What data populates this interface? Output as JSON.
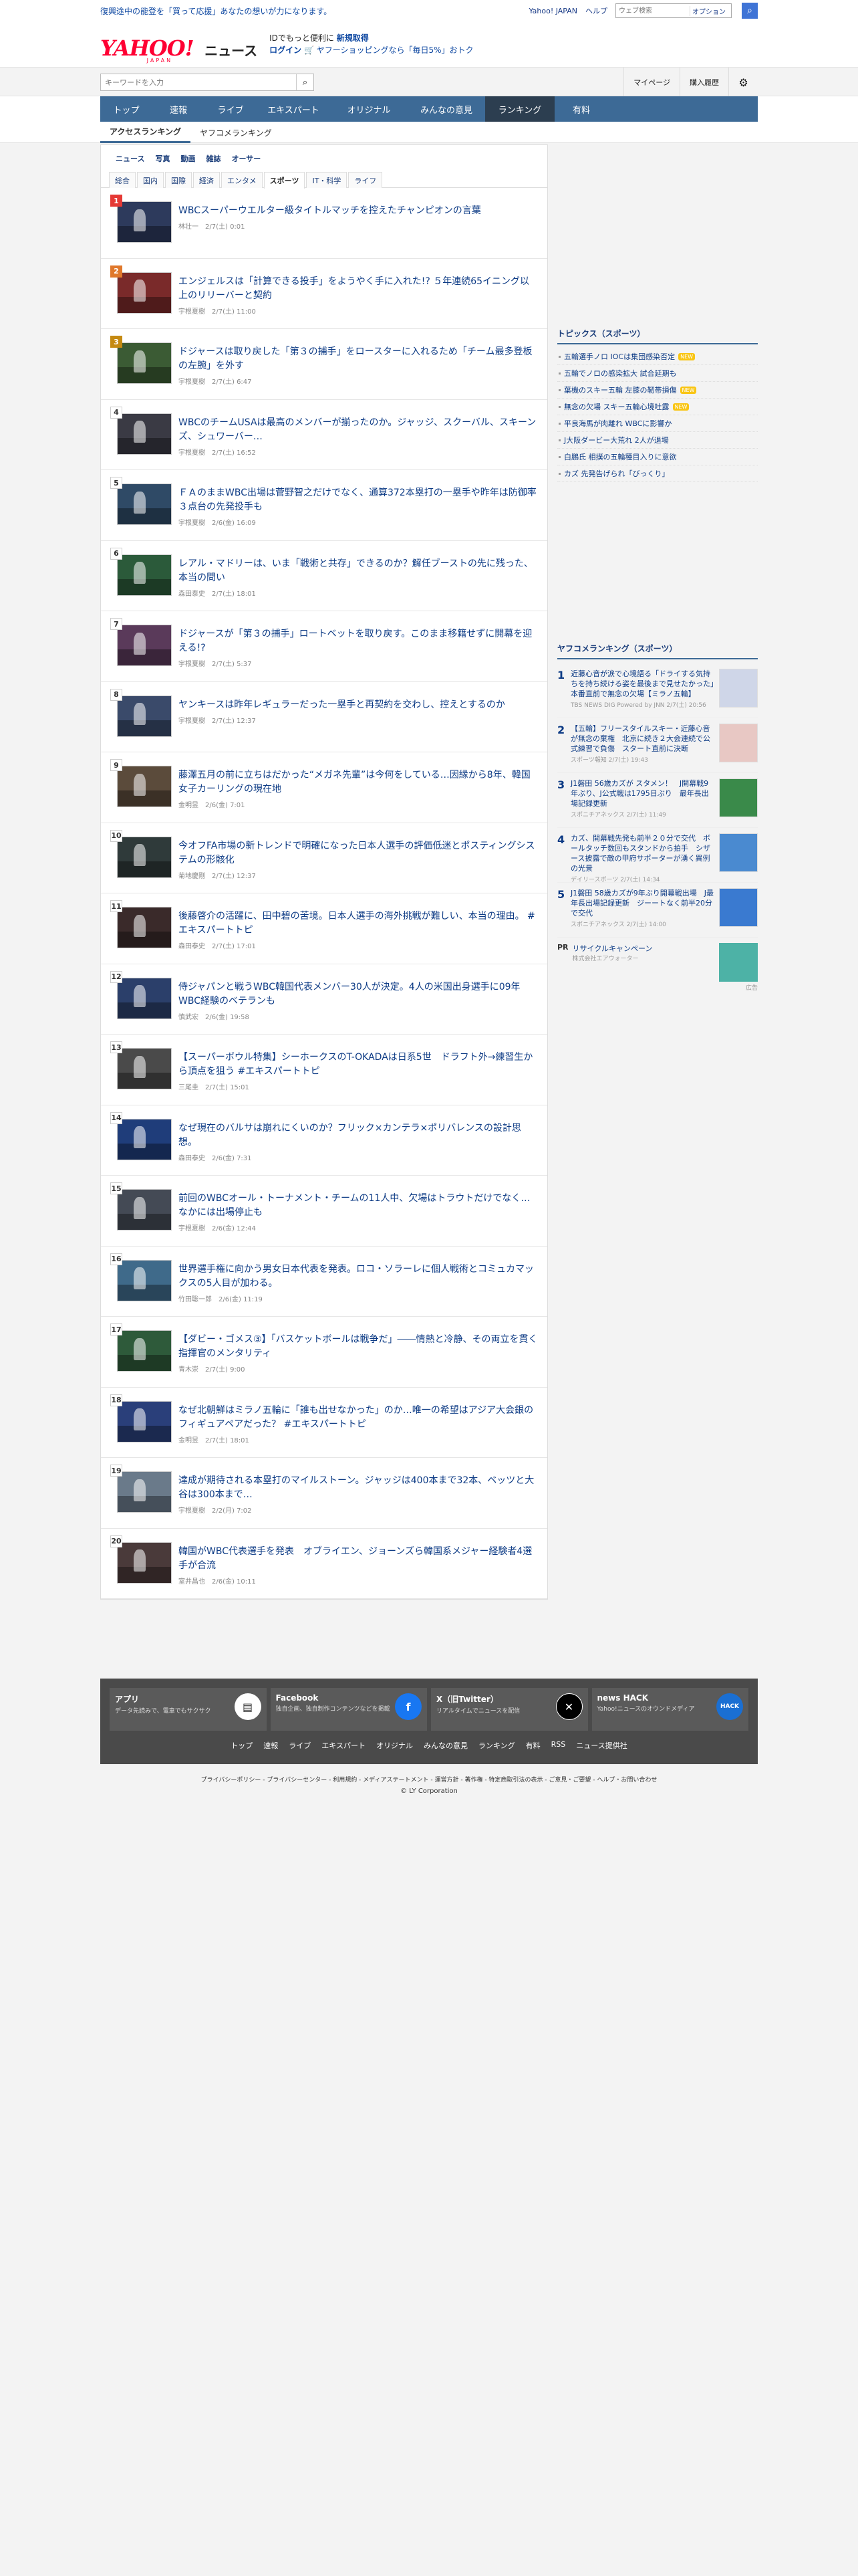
{
  "top_strip": {
    "ad_text": "復興途中の能登を「買って応援」あなたの想いが力になります。",
    "links": [
      "Yahoo! JAPAN",
      "ヘルプ"
    ],
    "search_placeholder": "ウェブ検索",
    "search_scope": "オプション"
  },
  "header": {
    "logo_main": "YAHOO!",
    "logo_sub": "JAPAN",
    "logo_news": "ニュース",
    "promo_line1_prefix": "IDでもっと便利に",
    "promo_line1_link": "新規取得",
    "promo_line2_login": "ログイン",
    "promo_line2_text": "ヤフーショッピングなら「毎日5%」おトク"
  },
  "searchbar": {
    "placeholder": "キーワードを入力",
    "right_items": [
      "マイページ",
      "購入履歴"
    ]
  },
  "nav": {
    "tabs": [
      "トップ",
      "速報",
      "ライブ",
      "エキスパート",
      "オリジナル",
      "みんなの意見",
      "ランキング",
      "有料"
    ],
    "active_index": 6
  },
  "subtabs": {
    "items": [
      "アクセスランキング",
      "ヤフコメランキング"
    ],
    "active_index": 0
  },
  "category_tabs": [
    "ニュース",
    "写真",
    "動画",
    "雑誌",
    "オーサー"
  ],
  "subcategory_tabs": {
    "items": [
      "総合",
      "国内",
      "国際",
      "経済",
      "エンタメ",
      "スポーツ",
      "IT・科学",
      "ライフ"
    ],
    "active_index": 5
  },
  "ranking": [
    {
      "rank": "1",
      "title": "WBCスーパーウエルター級タイトルマッチを控えたチャンピオンの言葉",
      "source": "林壮一",
      "time": "2/7(土) 0:01"
    },
    {
      "rank": "2",
      "title": "エンジェルスは「計算できる投手」をようやく手に入れた!? ５年連続65イニング以上のリリーバーと契約",
      "source": "宇根夏樹",
      "time": "2/7(土) 11:00"
    },
    {
      "rank": "3",
      "title": "ドジャースは取り戻した「第３の捕手」をロースターに入れるため「チーム最多登板の左腕」を外す",
      "source": "宇根夏樹",
      "time": "2/7(土) 6:47"
    },
    {
      "rank": "4",
      "title": "WBCのチームUSAは最高のメンバーが揃ったのか。ジャッジ、スクーバル、スキーンズ、シュワーバー…",
      "source": "宇根夏樹",
      "time": "2/7(土) 16:52"
    },
    {
      "rank": "5",
      "title": "ＦＡのままWBC出場は菅野智之だけでなく、通算372本塁打の一塁手や昨年は防御率３点台の先発投手も",
      "source": "宇根夏樹",
      "time": "2/6(金) 16:09"
    },
    {
      "rank": "6",
      "title": "レアル・マドリーは、いま「戦術と共存」できるのか？解任ブーストの先に残った、本当の問い",
      "source": "森田泰史",
      "time": "2/7(土) 18:01"
    },
    {
      "rank": "7",
      "title": "ドジャースが「第３の捕手」ロートベットを取り戻す。このまま移籍せずに開幕を迎える!?",
      "source": "宇根夏樹",
      "time": "2/7(土) 5:37"
    },
    {
      "rank": "8",
      "title": "ヤンキースは昨年レギュラーだった一塁手と再契約を交わし、控えとするのか",
      "source": "宇根夏樹",
      "time": "2/7(土) 12:37"
    },
    {
      "rank": "9",
      "title": "藤澤五月の前に立ちはだかった“メガネ先輩”は今何をしている…因縁から8年、韓国女子カーリングの現在地",
      "source": "金明昱",
      "time": "2/6(金) 7:01"
    },
    {
      "rank": "10",
      "title": "今オフFA市場の新トレンドで明確になった日本人選手の評価低迷とポスティングシステムの形骸化",
      "source": "菊地慶剛",
      "time": "2/7(土) 12:37"
    },
    {
      "rank": "11",
      "title": "後藤啓介の活躍に、田中碧の苦境。日本人選手の海外挑戦が難しい、本当の理由。 #エキスパートトピ",
      "source": "森田泰史",
      "time": "2/7(土) 17:01"
    },
    {
      "rank": "12",
      "title": "侍ジャパンと戦うWBC韓国代表メンバー30人が決定。4人の米国出身選手に09年WBC経験のベテランも",
      "source": "慎武宏",
      "time": "2/6(金) 19:58"
    },
    {
      "rank": "13",
      "title": "【スーパーボウル特集】シーホークスのT-OKADAは日系5世　ドラフト外→練習生から頂点を狙う #エキスパートトピ",
      "source": "三尾圭",
      "time": "2/7(土) 15:01"
    },
    {
      "rank": "14",
      "title": "なぜ現在のバルサは崩れにくいのか？フリック×カンテラ×ポリバレンスの設計思想。",
      "source": "森田泰史",
      "time": "2/6(金) 7:31"
    },
    {
      "rank": "15",
      "title": "前回のWBCオール・トーナメント・チームの11人中、欠場はトラウトだけでなく…なかには出場停止も",
      "source": "宇根夏樹",
      "time": "2/6(金) 12:44"
    },
    {
      "rank": "16",
      "title": "世界選手権に向かう男女日本代表を発表。ロコ・ソラーレに個人戦術とコミュカマックスの5人目が加わる。",
      "source": "竹田聡一郎",
      "time": "2/6(金) 11:19"
    },
    {
      "rank": "17",
      "title": "【ダビー・ゴメス③】「バスケットボールは戦争だ」――情熱と冷静、その両立を貫く指揮官のメンタリティ",
      "source": "青木崇",
      "time": "2/7(土) 9:00"
    },
    {
      "rank": "18",
      "title": "なぜ北朝鮮はミラノ五輪に「誰も出せなかった」のか…唯一の希望はアジア大会銀のフィギュアペアだった？ #エキスパートトピ",
      "source": "金明昱",
      "time": "2/7(土) 18:01"
    },
    {
      "rank": "19",
      "title": "達成が期待される本塁打のマイルストーン。ジャッジは400本まで32本、ベッツと大谷は300本まで…",
      "source": "宇根夏樹",
      "time": "2/2(月) 7:02"
    },
    {
      "rank": "20",
      "title": "韓国がWBC代表選手を発表　オブライエン、ジョーンズら韓国系メジャー経験者4選手が合流",
      "source": "室井昌也",
      "time": "2/6(金) 10:11"
    }
  ],
  "sidebar": {
    "topics_title": "トピックス（スポーツ）",
    "topics": [
      {
        "text": "五輪選手ノロ IOCは集団感染否定",
        "new": true
      },
      {
        "text": "五輪でノロの感染拡大 試合延期も",
        "new": false
      },
      {
        "text": "葉機のスキー五輪 左膝の靭帯損傷",
        "new": true
      },
      {
        "text": "無念の欠場 スキー五輪心境吐露",
        "new": true
      },
      {
        "text": "平良海馬が肉離れ WBCに影響か",
        "new": false
      },
      {
        "text": "J大阪ダービー大荒れ 2人が退場",
        "new": false
      },
      {
        "text": "白鵬氏 相撲の五輪種目入りに意欲",
        "new": false
      },
      {
        "text": "カズ 先発告げられ「びっくり」",
        "new": false
      }
    ],
    "new_badge": "NEW",
    "yahoo_ranking_title": "ヤフコメランキング（スポーツ）",
    "yahoo_ranking": [
      {
        "rank": "1",
        "title": "近藤心音が涙で心境語る「ドライする気持ちを持ち続ける姿を最後まで見せたかった」本番直前で無念の欠場【ミラノ五輪】",
        "meta": "TBS NEWS DIG Powered by JNN 2/7(土) 20:56"
      },
      {
        "rank": "2",
        "title": "【五輪】フリースタイルスキー・近藤心音が無念の棄権　北京に続き２大会連続で公式練習で負傷　スタート直前に決断",
        "meta": "スポーツ報知 2/7(土) 19:43"
      },
      {
        "rank": "3",
        "title": "J1磐田 56歳カズが スタメン！　J開幕戦9年ぶり、J公式戦は1795日ぶり　最年長出場記録更新",
        "meta": "スポニチアネックス 2/7(土) 11:49"
      },
      {
        "rank": "4",
        "title": "カズ、開幕戦先発も前半２０分で交代　ボールタッチ数回もスタンドから拍手　シザース披露で敵の甲府サポーターが湧く異例の光景",
        "meta": "デイリースポーツ 2/7(土) 14:34"
      },
      {
        "rank": "5",
        "title": "J1磐田 58歳カズが9年ぶり開幕戦出場　J最年長出場記録更新　ジーートなく前半20分で交代",
        "meta": "スポニチアネックス 2/7(土) 14:00"
      }
    ],
    "pr_label": "PR",
    "pr_title": "リサイクルキャンペーン",
    "pr_sub": "株式会社エアウォーター",
    "ad_label": "広告"
  },
  "footer": {
    "cards": [
      {
        "title": "アプリ",
        "desc": "データ先読みで、電車でもサクサク"
      },
      {
        "title": "Facebook",
        "desc": "独自企画、独自制作コンテンツなどを掲載"
      },
      {
        "title": "X（旧Twitter）",
        "desc": "リアルタイムでニュースを配信"
      },
      {
        "title": "news HACK",
        "desc": "Yahoo!ニュースのオウンドメディア"
      }
    ],
    "nav": [
      "トップ",
      "速報",
      "ライブ",
      "エキスパート",
      "オリジナル",
      "みんなの意見",
      "ランキング",
      "有料",
      "RSS",
      "ニュース提供社"
    ],
    "legal": "プライバシーポリシー - プライバシーセンター - 利用規約 - メディアステートメント - 運営方針 - 著作権 - 特定商取引法の表示 - ご意見・ご要望 - ヘルプ・お問い合わせ",
    "copyright": "© LY Corporation"
  }
}
